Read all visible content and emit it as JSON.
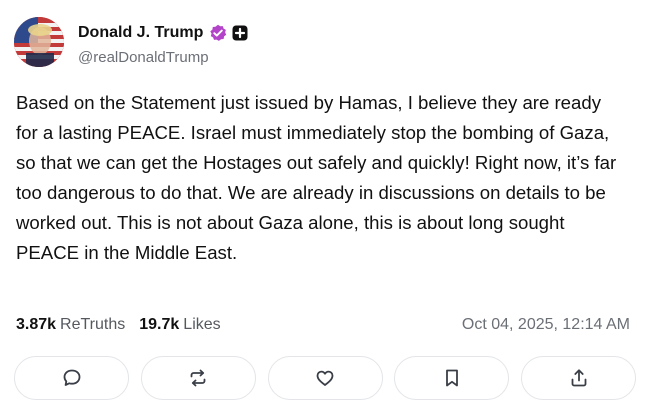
{
  "author": {
    "display_name": "Donald J. Trump",
    "handle": "@realDonaldTrump",
    "avatar_icon": "avatar-flag-portrait",
    "verified_color": "#b344c9"
  },
  "post": {
    "text": "Based on the Statement just issued by Hamas, I believe they are ready for a lasting PEACE. Israel must immediately stop the bombing of Gaza, so that we can get the Hostages out safely and quickly! Right now, it’s far too dangerous to do that. We are already in discussions on details to be worked out. This is not about Gaza alone, this is about long sought PEACE in the Middle East."
  },
  "stats": {
    "retruths_count": "3.87k",
    "retruths_label": "ReTruths",
    "likes_count": "19.7k",
    "likes_label": "Likes",
    "timestamp": "Oct 04, 2025, 12:14 AM"
  },
  "actions": [
    {
      "icon": "reply-icon"
    },
    {
      "icon": "retruth-icon"
    },
    {
      "icon": "like-icon"
    },
    {
      "icon": "bookmark-icon"
    },
    {
      "icon": "share-icon"
    }
  ]
}
